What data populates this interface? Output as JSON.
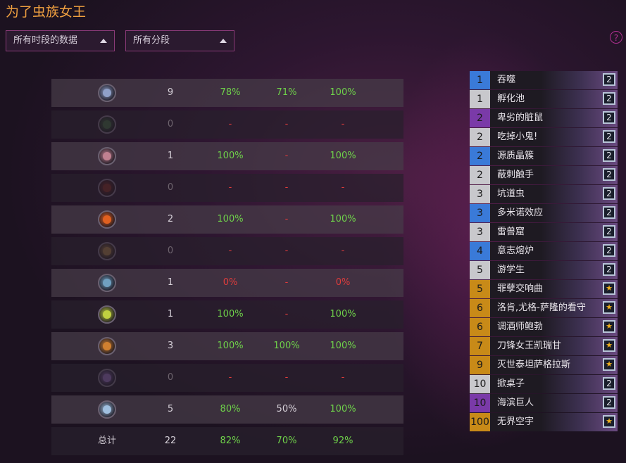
{
  "title": "为了虫族女王",
  "filters": {
    "period": "所有时段的数据",
    "rank": "所有分段"
  },
  "help_label": "?",
  "rows": [
    {
      "icon": "crossed-swords-icon",
      "color": "#8fa0c8",
      "dim": false,
      "c1": "9",
      "c2": "78%",
      "c3": "71%",
      "c4": "100%",
      "k1": "white",
      "k2": "green",
      "k3": "green",
      "k4": "green"
    },
    {
      "icon": "creature-portrait-icon",
      "color": "#3a5a3a",
      "dim": true,
      "c1": "0",
      "c2": "-",
      "c3": "-",
      "c4": "-",
      "k1": "gray",
      "k2": "red",
      "k3": "red",
      "k4": "red"
    },
    {
      "icon": "shell-icon",
      "color": "#c08090",
      "dim": false,
      "c1": "1",
      "c2": "100%",
      "c3": "-",
      "c4": "100%",
      "k1": "white",
      "k2": "green",
      "k3": "red",
      "k4": "green"
    },
    {
      "icon": "claw-icon",
      "color": "#6a2a20",
      "dim": true,
      "c1": "0",
      "c2": "-",
      "c3": "-",
      "c4": "-",
      "k1": "gray",
      "k2": "red",
      "k3": "red",
      "k4": "red"
    },
    {
      "icon": "fire-blade-icon",
      "color": "#e06020",
      "dim": false,
      "c1": "2",
      "c2": "100%",
      "c3": "-",
      "c4": "100%",
      "k1": "white",
      "k2": "green",
      "k3": "red",
      "k4": "green"
    },
    {
      "icon": "horn-icon",
      "color": "#8a6a40",
      "dim": true,
      "c1": "0",
      "c2": "-",
      "c3": "-",
      "c4": "-",
      "k1": "gray",
      "k2": "red",
      "k3": "red",
      "k4": "red"
    },
    {
      "icon": "mechanical-arm-icon",
      "color": "#70a0c0",
      "dim": false,
      "c1": "1",
      "c2": "0%",
      "c3": "-",
      "c4": "0%",
      "k1": "white",
      "k2": "red",
      "k3": "red",
      "k4": "red"
    },
    {
      "icon": "lightning-claw-icon",
      "color": "#c0d040",
      "dim": false,
      "c1": "1",
      "c2": "100%",
      "c3": "-",
      "c4": "100%",
      "k1": "white",
      "k2": "green",
      "k3": "red",
      "k4": "green"
    },
    {
      "icon": "horned-helm-icon",
      "color": "#d08030",
      "dim": false,
      "c1": "3",
      "c2": "100%",
      "c3": "100%",
      "c4": "100%",
      "k1": "white",
      "k2": "green",
      "k3": "green",
      "k4": "green"
    },
    {
      "icon": "spectral-hand-icon",
      "color": "#8060a0",
      "dim": true,
      "c1": "0",
      "c2": "-",
      "c3": "-",
      "c4": "-",
      "k1": "gray",
      "k2": "red",
      "k3": "red",
      "k4": "red"
    },
    {
      "icon": "sword-icon",
      "color": "#a0c0e0",
      "dim": false,
      "c1": "5",
      "c2": "80%",
      "c3": "50%",
      "c4": "100%",
      "k1": "white",
      "k2": "green",
      "k3": "white",
      "k4": "green"
    }
  ],
  "total": {
    "label": "总计",
    "c1": "22",
    "c2": "82%",
    "c3": "70%",
    "c4": "92%"
  },
  "cards": [
    {
      "cost": "1",
      "name": "吞噬",
      "rarity": "#3a7ad8",
      "count": "2",
      "star": false
    },
    {
      "cost": "1",
      "name": "孵化池",
      "rarity": "#c8c8cc",
      "count": "2",
      "star": false
    },
    {
      "cost": "2",
      "name": "卑劣的脏鼠",
      "rarity": "#7a3aa8",
      "count": "2",
      "star": false
    },
    {
      "cost": "2",
      "name": "吃掉小鬼!",
      "rarity": "#c8c8cc",
      "count": "2",
      "star": false
    },
    {
      "cost": "2",
      "name": "源质晶簇",
      "rarity": "#3a7ad8",
      "count": "2",
      "star": false
    },
    {
      "cost": "2",
      "name": "蔽刺触手",
      "rarity": "#c8c8cc",
      "count": "2",
      "star": false
    },
    {
      "cost": "3",
      "name": "坑道虫",
      "rarity": "#c8c8cc",
      "count": "2",
      "star": false
    },
    {
      "cost": "3",
      "name": "多米诺效应",
      "rarity": "#3a7ad8",
      "count": "2",
      "star": false
    },
    {
      "cost": "3",
      "name": "雷兽窟",
      "rarity": "#c8c8cc",
      "count": "2",
      "star": false
    },
    {
      "cost": "4",
      "name": "意志熔炉",
      "rarity": "#3a7ad8",
      "count": "2",
      "star": false
    },
    {
      "cost": "5",
      "name": "游学生",
      "rarity": "#c8c8cc",
      "count": "2",
      "star": false
    },
    {
      "cost": "5",
      "name": "罪孽交响曲",
      "rarity": "#c88a18",
      "count": "★",
      "star": true
    },
    {
      "cost": "6",
      "name": "洛肯,尤格-萨隆的看守",
      "rarity": "#c88a18",
      "count": "★",
      "star": true
    },
    {
      "cost": "6",
      "name": "调酒师鲍勃",
      "rarity": "#c88a18",
      "count": "★",
      "star": true
    },
    {
      "cost": "7",
      "name": "刀锋女王凯瑞甘",
      "rarity": "#c88a18",
      "count": "★",
      "star": true
    },
    {
      "cost": "9",
      "name": "灭世泰坦萨格拉斯",
      "rarity": "#c88a18",
      "count": "★",
      "star": true
    },
    {
      "cost": "10",
      "name": "掀桌子",
      "rarity": "#c8c8cc",
      "count": "2",
      "star": false
    },
    {
      "cost": "10",
      "name": "海滨巨人",
      "rarity": "#7a3aa8",
      "count": "2",
      "star": false
    },
    {
      "cost": "100",
      "name": "无界空宇",
      "rarity": "#c88a18",
      "count": "★",
      "star": true
    }
  ]
}
